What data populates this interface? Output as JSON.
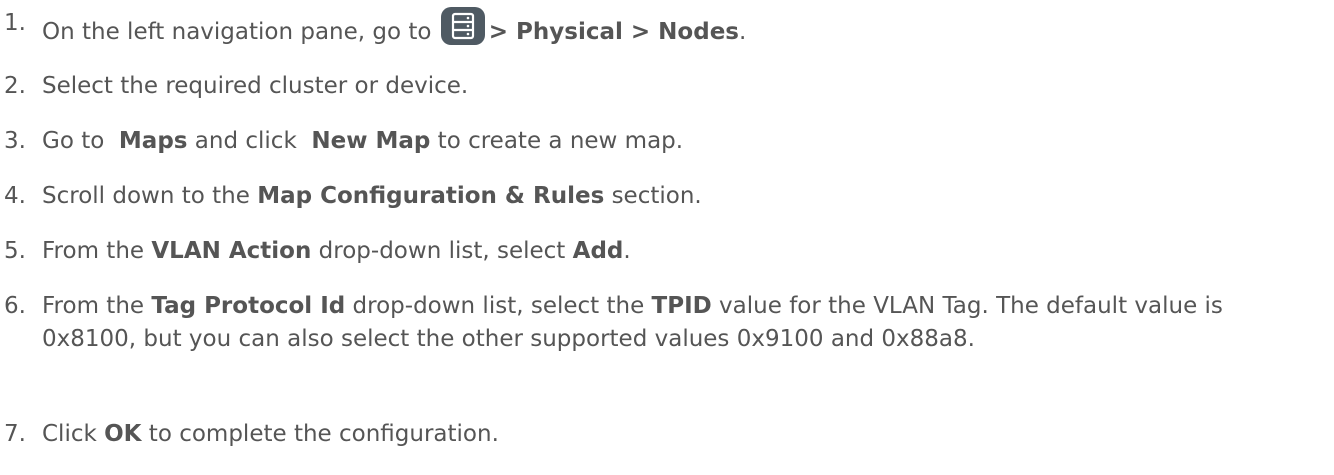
{
  "steps": [
    {
      "num": "1.",
      "parts": {
        "before": "On the left navigation pane, go to ",
        "icon": "server-list-icon",
        "path": "> Physical > Nodes",
        "after": "."
      }
    },
    {
      "num": "2.",
      "parts": {
        "text": "Select the required cluster or device."
      }
    },
    {
      "num": "3.",
      "parts": {
        "t1": "Go to  ",
        "b1": "Maps",
        "t2": " and click  ",
        "b2": "New Map",
        "t3": " to create a new map."
      }
    },
    {
      "num": "4.",
      "parts": {
        "t1": "Scroll down to the ",
        "b1": "Map Configuration & Rules",
        "t2": " section."
      }
    },
    {
      "num": "5.",
      "parts": {
        "t1": "From the ",
        "b1": "VLAN Action",
        "t2": " drop-down list, select ",
        "b2": "Add",
        "t3": "."
      }
    },
    {
      "num": "6.",
      "parts": {
        "t1": "From the ",
        "b1": "Tag Protocol Id",
        "t2": " drop-down list, select the ",
        "b2": "TPID",
        "t3": " value for the VLAN Tag. The default value is 0x8100, but you can also select the other supported values 0x9100 and 0x88a8."
      }
    },
    {
      "num": "7.",
      "parts": {
        "t1": "Click ",
        "b1": "OK",
        "t2": " to complete the configuration."
      }
    }
  ],
  "colors": {
    "text": "#555555",
    "icon_bg": "#4f5a63",
    "icon_fg": "#ffffff"
  }
}
